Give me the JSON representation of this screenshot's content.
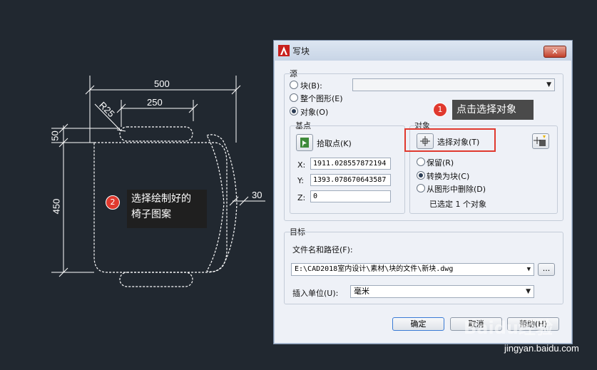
{
  "drawing": {
    "dim_500": "500",
    "dim_250": "250",
    "dim_r25": "R25",
    "dim_50": "50",
    "dim_450": "450",
    "dim_30": "30"
  },
  "callouts": {
    "left_badge": "2",
    "left_line1": "选择绘制好的",
    "left_line2": "椅子图案",
    "right_badge": "1",
    "right_text": "点击选择对象"
  },
  "dialog": {
    "title": "写块",
    "close_label": "✕",
    "source": {
      "group_label": "源",
      "radio_block": "块(B):",
      "radio_entire": "整个图形(E)",
      "radio_objects": "对象(O)",
      "selected": "对象(O)",
      "block_combo_value": ""
    },
    "basepoint": {
      "group_label": "基点",
      "pick_label": "拾取点(K)",
      "x_label": "X:",
      "x_value": "1911.028557872194",
      "y_label": "Y:",
      "y_value": "1393.078670643587",
      "z_label": "Z:",
      "z_value": "0"
    },
    "objects": {
      "group_label": "对象",
      "select_label": "选择对象(T)",
      "radio_retain": "保留(R)",
      "radio_convert": "转换为块(C)",
      "radio_delete": "从图形中删除(D)",
      "selected": "转换为块(C)",
      "status": "已选定 1 个对象"
    },
    "target": {
      "group_label": "目标",
      "path_label": "文件名和路径(F):",
      "path_value": "E:\\CAD2018室内设计\\素材\\块的文件\\新块.dwg",
      "browse_label": "...",
      "units_label": "插入单位(U):",
      "units_value": "毫米"
    },
    "buttons": {
      "ok": "确定",
      "cancel": "取消",
      "help": "帮助(H)"
    }
  },
  "watermark": {
    "logo": "Baidu经验",
    "url": "jingyan.baidu.com"
  },
  "colors": {
    "background": "#212830",
    "callout_badge": "#e0392e",
    "highlight_box": "#e0392e"
  }
}
